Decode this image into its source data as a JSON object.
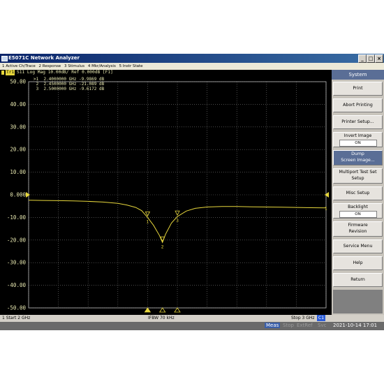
{
  "window": {
    "title": "E5071C Network Analyzer",
    "buttons": [
      "_",
      "□",
      "×"
    ]
  },
  "menu": [
    "1 Active Ch/Trace",
    "2 Response",
    "3 Stimulus",
    "4 Mkr/Analysis",
    "5 Instr State"
  ],
  "trace": {
    "id": "Tr1",
    "header": "S11 Log Mag 10.00dB/ Ref 0.000dB [F1]",
    "color": "#e6d63c"
  },
  "markers": [
    {
      "label": ">1",
      "freq": "2.4000000 GHz",
      "value": "-9.9869 dB",
      "freq_ghz": 2.4,
      "db": -9.9869,
      "tag": "1"
    },
    {
      "label": "2",
      "freq": "2.4500000 GHz",
      "value": "-21.089 dB",
      "freq_ghz": 2.45,
      "db": -21.089,
      "tag": "2"
    },
    {
      "label": "3",
      "freq": "2.5000000 GHz",
      "value": "-9.6172 dB",
      "freq_ghz": 2.5,
      "db": -9.6172,
      "tag": "3"
    }
  ],
  "chart_data": {
    "type": "line",
    "xlim": [
      2,
      3
    ],
    "ylim": [
      -50,
      50
    ],
    "yticks": [
      "50.00",
      "40.00",
      "30.00",
      "20.00",
      "10.00",
      "0.000",
      "-10.00",
      "-20.00",
      "-30.00",
      "-40.00",
      "-50.00"
    ],
    "grid": true,
    "series": [
      {
        "x": [
          2.0,
          2.05,
          2.1,
          2.15,
          2.2,
          2.25,
          2.3,
          2.33,
          2.36,
          2.38,
          2.4,
          2.42,
          2.44,
          2.45,
          2.46,
          2.48,
          2.5,
          2.53,
          2.56,
          2.6,
          2.65,
          2.7,
          2.75,
          2.8,
          2.85,
          2.9,
          2.95,
          3.0
        ],
        "y": [
          -2.4,
          -2.5,
          -2.6,
          -2.7,
          -2.9,
          -3.2,
          -3.8,
          -4.5,
          -5.6,
          -7.0,
          -9.99,
          -13.5,
          -18.0,
          -21.09,
          -17.5,
          -12.5,
          -9.62,
          -7.2,
          -6.0,
          -5.4,
          -5.2,
          -5.2,
          -5.3,
          -5.4,
          -5.5,
          -5.6,
          -5.7,
          -5.8
        ]
      }
    ]
  },
  "sidepanel": {
    "title": "System",
    "buttons": [
      {
        "line1": "Print"
      },
      {
        "line1": "Abort Printing"
      },
      {
        "line1": "Printer Setup..."
      },
      {
        "line1": "Invert Image",
        "value": "ON"
      },
      {
        "line1": "Dump",
        "line2": "Screen Image..."
      },
      {
        "line1": "Multiport Test Set",
        "line2": "Setup"
      },
      {
        "line1": "Misc Setup"
      },
      {
        "line1": "Backlight",
        "value": "ON"
      },
      {
        "line1": "Firmware",
        "line2": "Revision"
      },
      {
        "line1": "Service Menu"
      },
      {
        "line1": "Help"
      },
      {
        "line1": "Return"
      }
    ]
  },
  "status": {
    "start": "1  Start 2 GHz",
    "ifbw": "IFBW 70 kHz",
    "stop": "Stop 3 GHz",
    "channel_badge": "C1"
  },
  "bottombar": {
    "items": [
      "Meas",
      "Stop",
      "ExtRef",
      "Svc"
    ],
    "datetime": "2021-10-14 17:01"
  }
}
